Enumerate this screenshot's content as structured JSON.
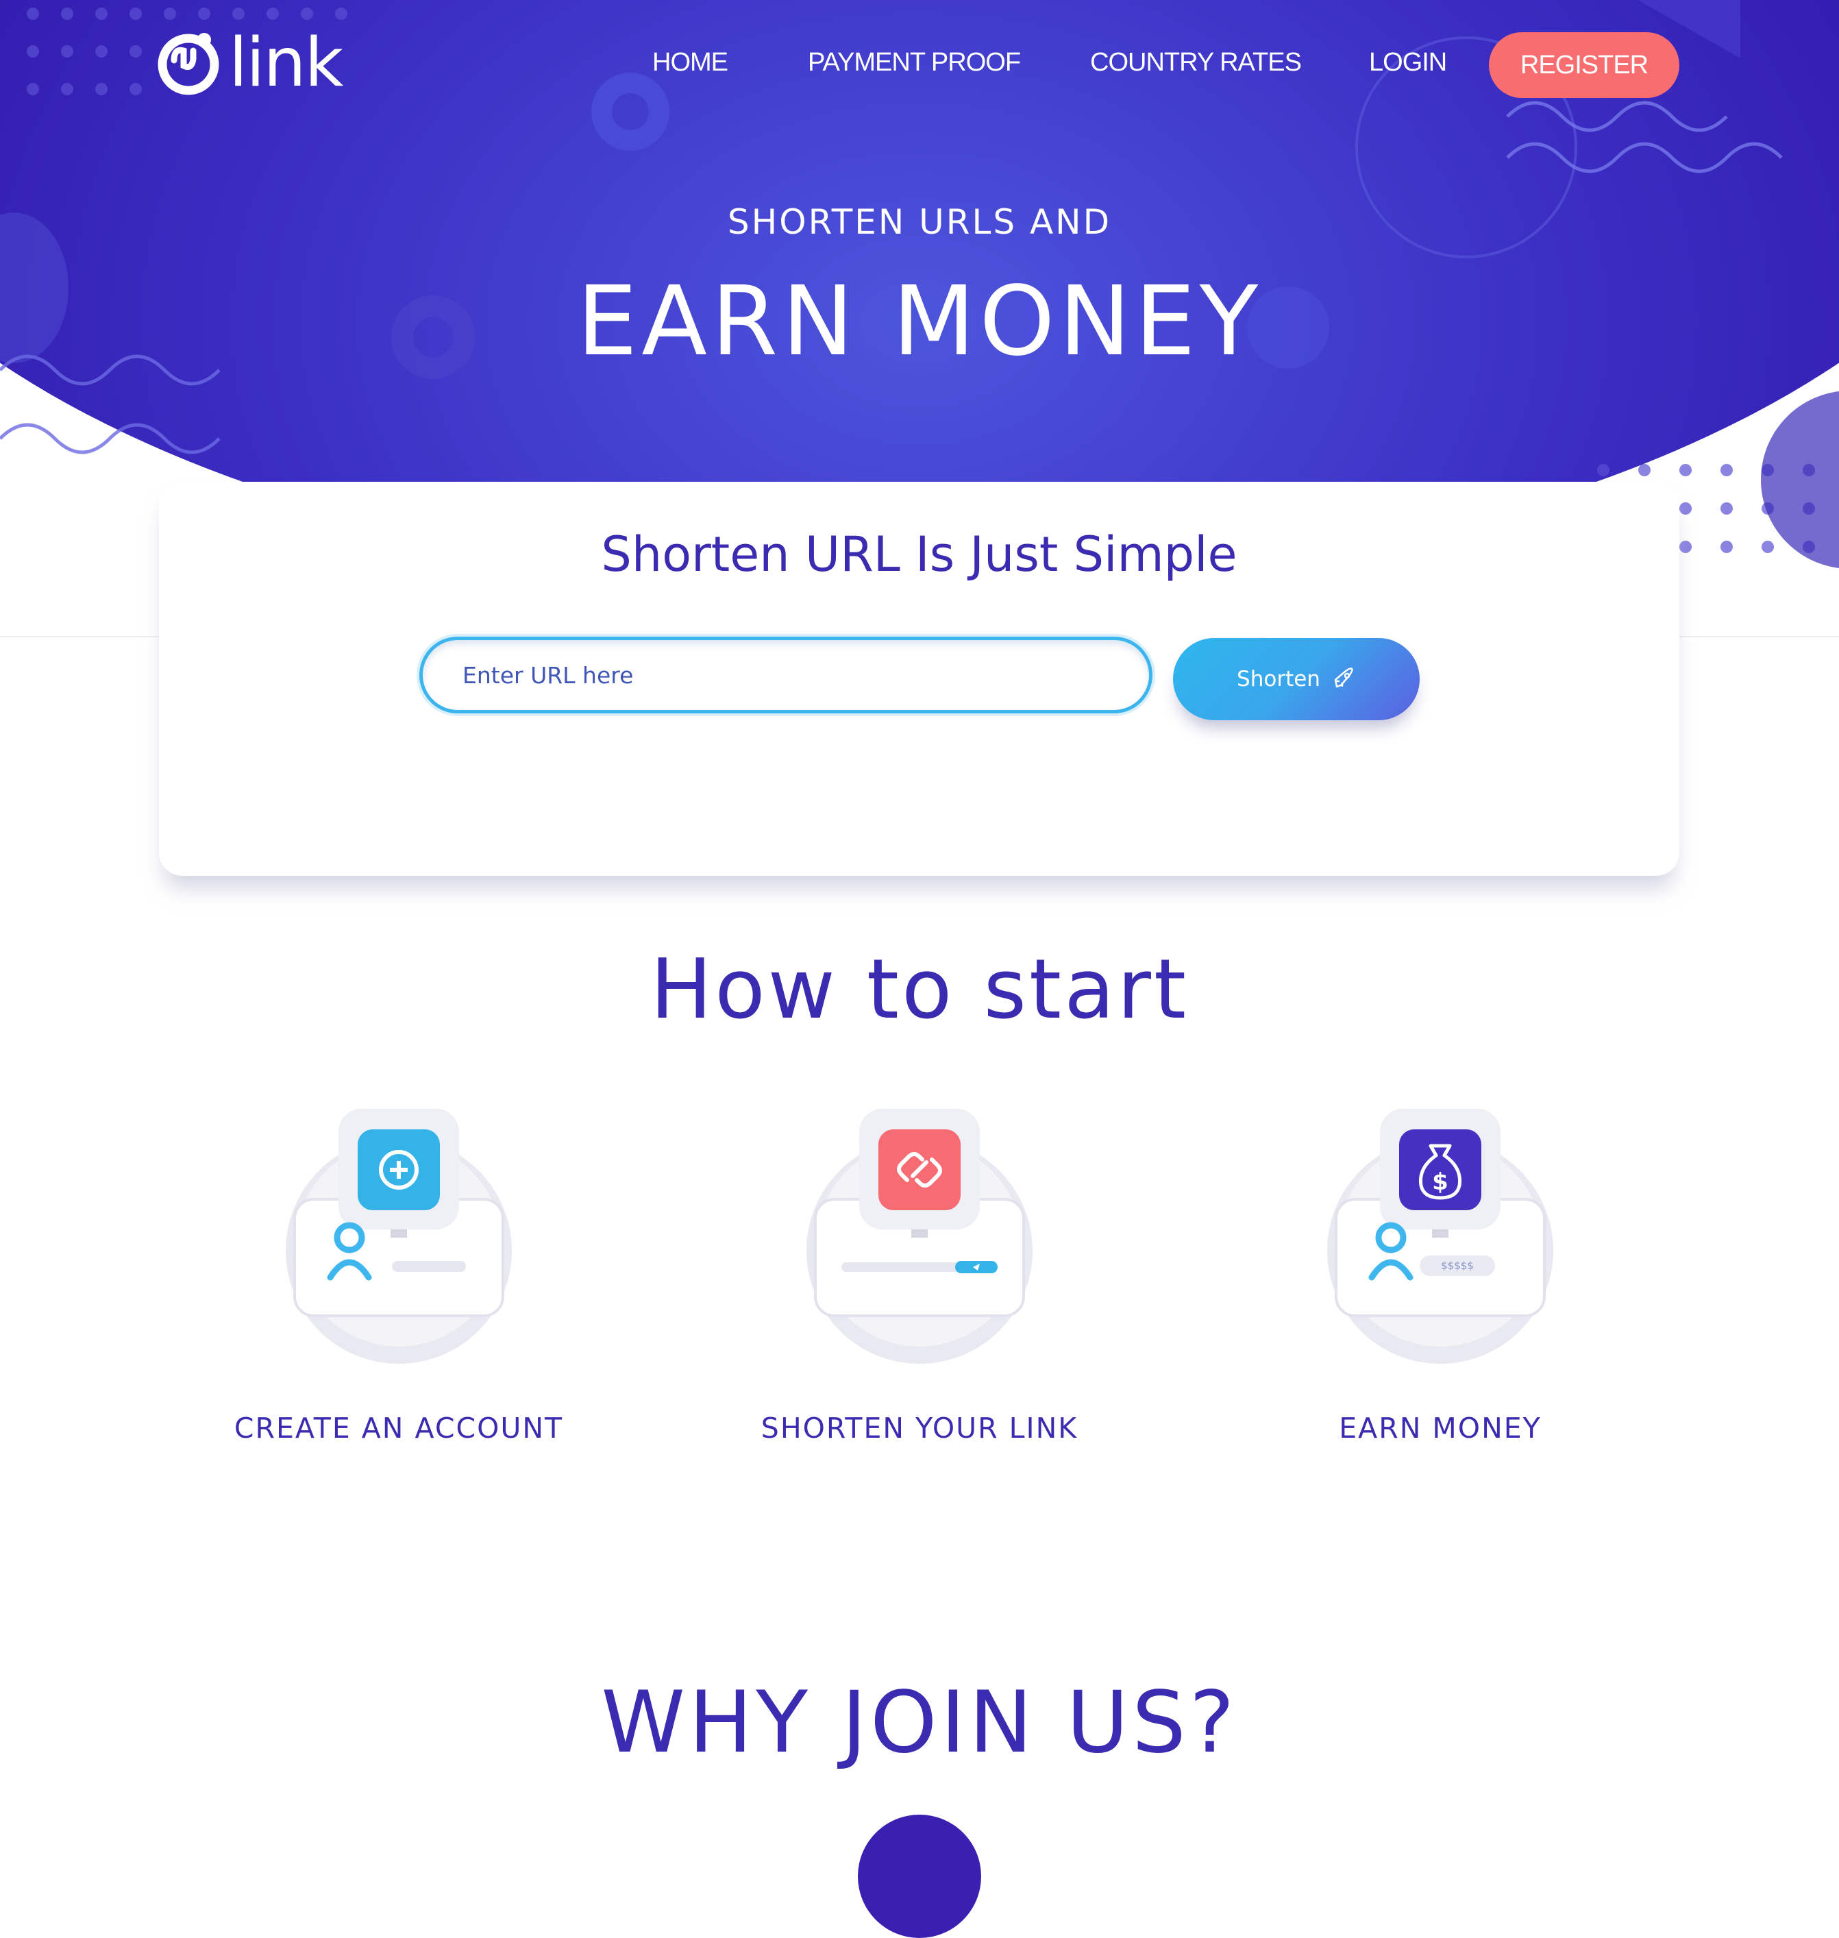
{
  "logo": {
    "text": "link"
  },
  "nav": {
    "items": [
      "HOME",
      "PAYMENT PROOF",
      "COUNTRY RATES",
      "LOGIN"
    ],
    "register": "REGISTER"
  },
  "hero": {
    "subtitle": "SHORTEN URLS AND",
    "title": "EARN MONEY"
  },
  "shorten_card": {
    "title": "Shorten URL Is Just Simple",
    "input_placeholder": "Enter URL here",
    "button_label": "Shorten"
  },
  "how_to_start": {
    "title": "How to start",
    "steps": [
      {
        "label": "CREATE AN ACCOUNT",
        "icon": "add-account-icon"
      },
      {
        "label": "SHORTEN YOUR LINK",
        "icon": "chain-link-icon"
      },
      {
        "label": "EARN MONEY",
        "icon": "money-bag-icon",
        "screen_text": "$$$$$"
      }
    ]
  },
  "why_join": {
    "title": "WHY JOIN US?"
  },
  "colors": {
    "primary": "#3b2bb0",
    "hero_bg": "#2f16a8",
    "register": "#f86d70",
    "accent_blue": "#2fb6ed"
  }
}
